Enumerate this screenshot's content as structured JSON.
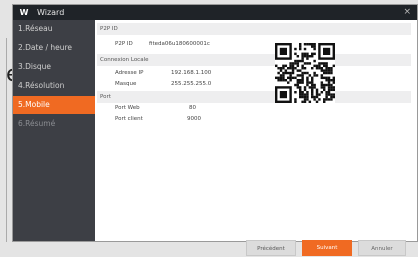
{
  "window": {
    "title": "Wizard",
    "logo_text": "W",
    "close_glyph": "×"
  },
  "sidebar": {
    "items": [
      {
        "label": "1.Réseau",
        "state": "normal"
      },
      {
        "label": "2.Date / heure",
        "state": "normal"
      },
      {
        "label": "3.Disque",
        "state": "normal"
      },
      {
        "label": "4.Résolution",
        "state": "normal"
      },
      {
        "label": "5.Mobile",
        "state": "active"
      },
      {
        "label": "6.Résumé",
        "state": "disabled"
      }
    ]
  },
  "p2p": {
    "header": "P2P ID",
    "id_label": "P2P ID",
    "id_value": "fiteda06u180600001c"
  },
  "local": {
    "header": "Connexion Locale",
    "ip_label": "Adresse IP",
    "ip_value": "192.168.1.100",
    "mask_label": "Masque",
    "mask_value": "255.255.255.0"
  },
  "port": {
    "header": "Port",
    "web_label": "Port Web",
    "web_value": "80",
    "client_label": "Port client",
    "client_value": "9000"
  },
  "buttons": {
    "prev": "Précédent",
    "next": "Suivant",
    "cancel": "Annuler"
  },
  "background": {
    "letter": "e"
  },
  "colors": {
    "accent": "#f06a22",
    "sidebar_bg": "#3d3f45",
    "titlebar_bg": "#1f2328"
  }
}
